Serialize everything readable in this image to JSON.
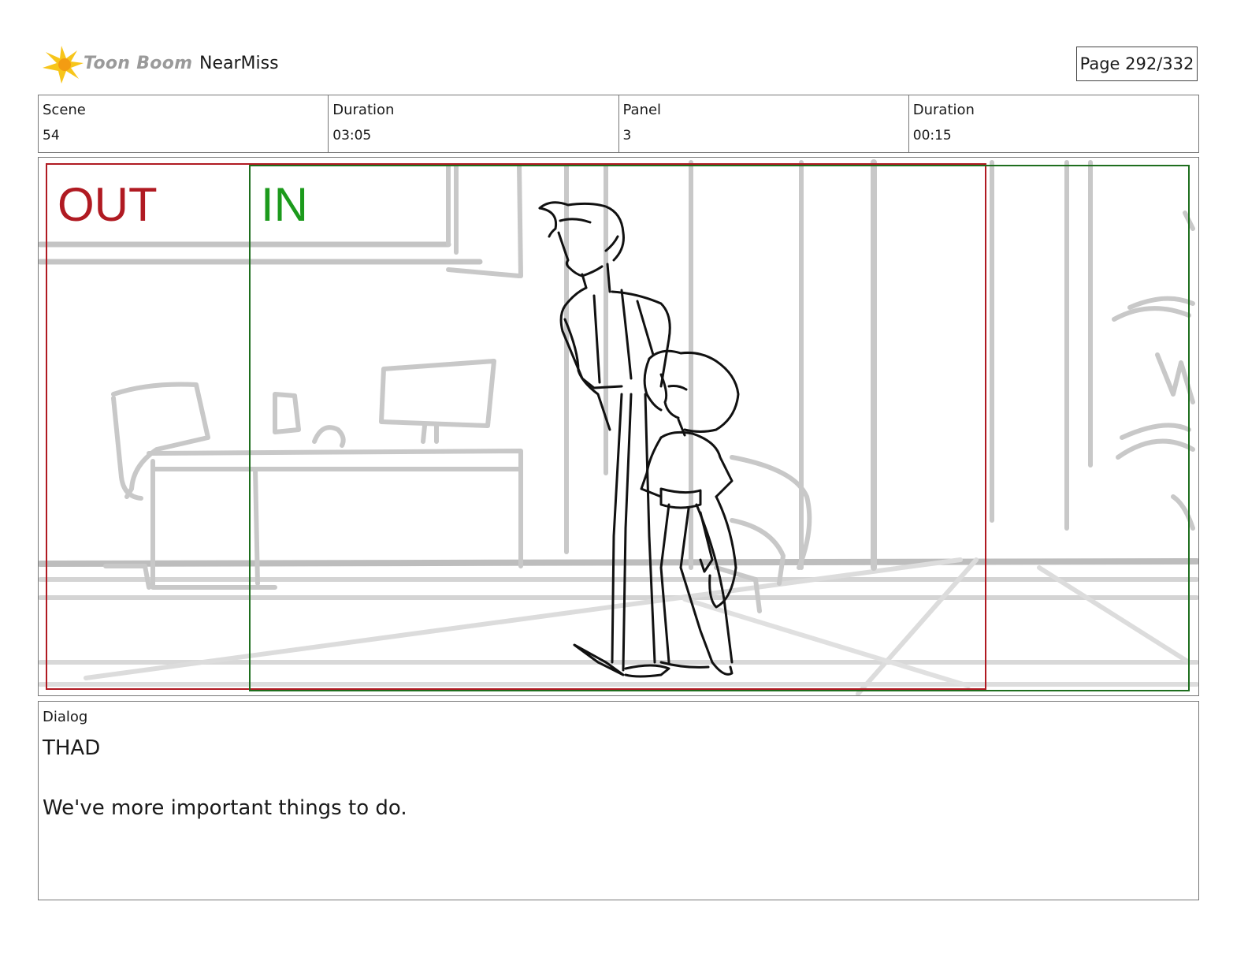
{
  "header": {
    "logo_text": "Toon Boom",
    "project_name": "NearMiss",
    "page_label": "Page 292/332"
  },
  "info": [
    {
      "label": "Scene",
      "value": "54"
    },
    {
      "label": "Duration",
      "value": "03:05"
    },
    {
      "label": "Panel",
      "value": "3"
    },
    {
      "label": "Duration",
      "value": "00:15"
    }
  ],
  "panel": {
    "out_label": "OUT",
    "in_label": "IN",
    "out_color": "#b01a22",
    "in_color": "#1c9a1c"
  },
  "dialog": {
    "label": "Dialog",
    "speaker": "THAD",
    "line": "We've more important things to do."
  }
}
